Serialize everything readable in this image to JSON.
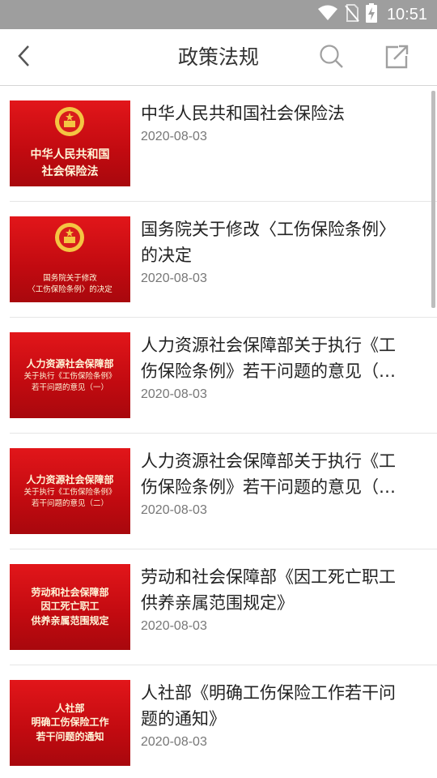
{
  "status_bar": {
    "time": "10:51",
    "icons": [
      "wifi-icon",
      "no-sim-icon",
      "battery-charging-icon"
    ]
  },
  "header": {
    "title": "政策法规",
    "back_icon": "back-arrow-icon",
    "search_icon": "search-icon",
    "share_icon": "share-icon"
  },
  "items": [
    {
      "title": "中华人民共和国社会保险法",
      "date": "2020-08-03",
      "thumb_emblem": true,
      "thumb_lines": [
        "中华人民共和国",
        "社会保险法"
      ]
    },
    {
      "title": "国务院关于修改〈工伤保险条例〉的决定",
      "date": "2020-08-03",
      "thumb_emblem": true,
      "thumb_lines": [
        "国务院关于修改",
        "〈工伤保险条例〉的决定"
      ]
    },
    {
      "title": "人力资源社会保障部关于执行《工伤保险条例》若干问题的意见（…",
      "date": "2020-08-03",
      "thumb_emblem": false,
      "thumb_lines": [
        "人力资源社会保障部",
        "关于执行《工伤保险条例》",
        "若干问题的意见（一）"
      ]
    },
    {
      "title": "人力资源社会保障部关于执行《工伤保险条例》若干问题的意见（…",
      "date": "2020-08-03",
      "thumb_emblem": false,
      "thumb_lines": [
        "人力资源社会保障部",
        "关于执行《工伤保险条例》",
        "若干问题的意见（二）"
      ]
    },
    {
      "title": "劳动和社会保障部《因工死亡职工供养亲属范围规定》",
      "date": "2020-08-03",
      "thumb_emblem": false,
      "thumb_lines": [
        "劳动和社会保障部",
        "因工死亡职工",
        "供养亲属范围规定"
      ]
    },
    {
      "title": "人社部《明确工伤保险工作若干问题的通知》",
      "date": "2020-08-03",
      "thumb_emblem": false,
      "thumb_lines": [
        "人社部",
        "明确工伤保险工作",
        "若干问题的通知"
      ]
    }
  ],
  "colors": {
    "status_bar": "#9e9e9e",
    "thumb_red": "#d0101a",
    "title_text": "#333333",
    "date_text": "#777777"
  }
}
